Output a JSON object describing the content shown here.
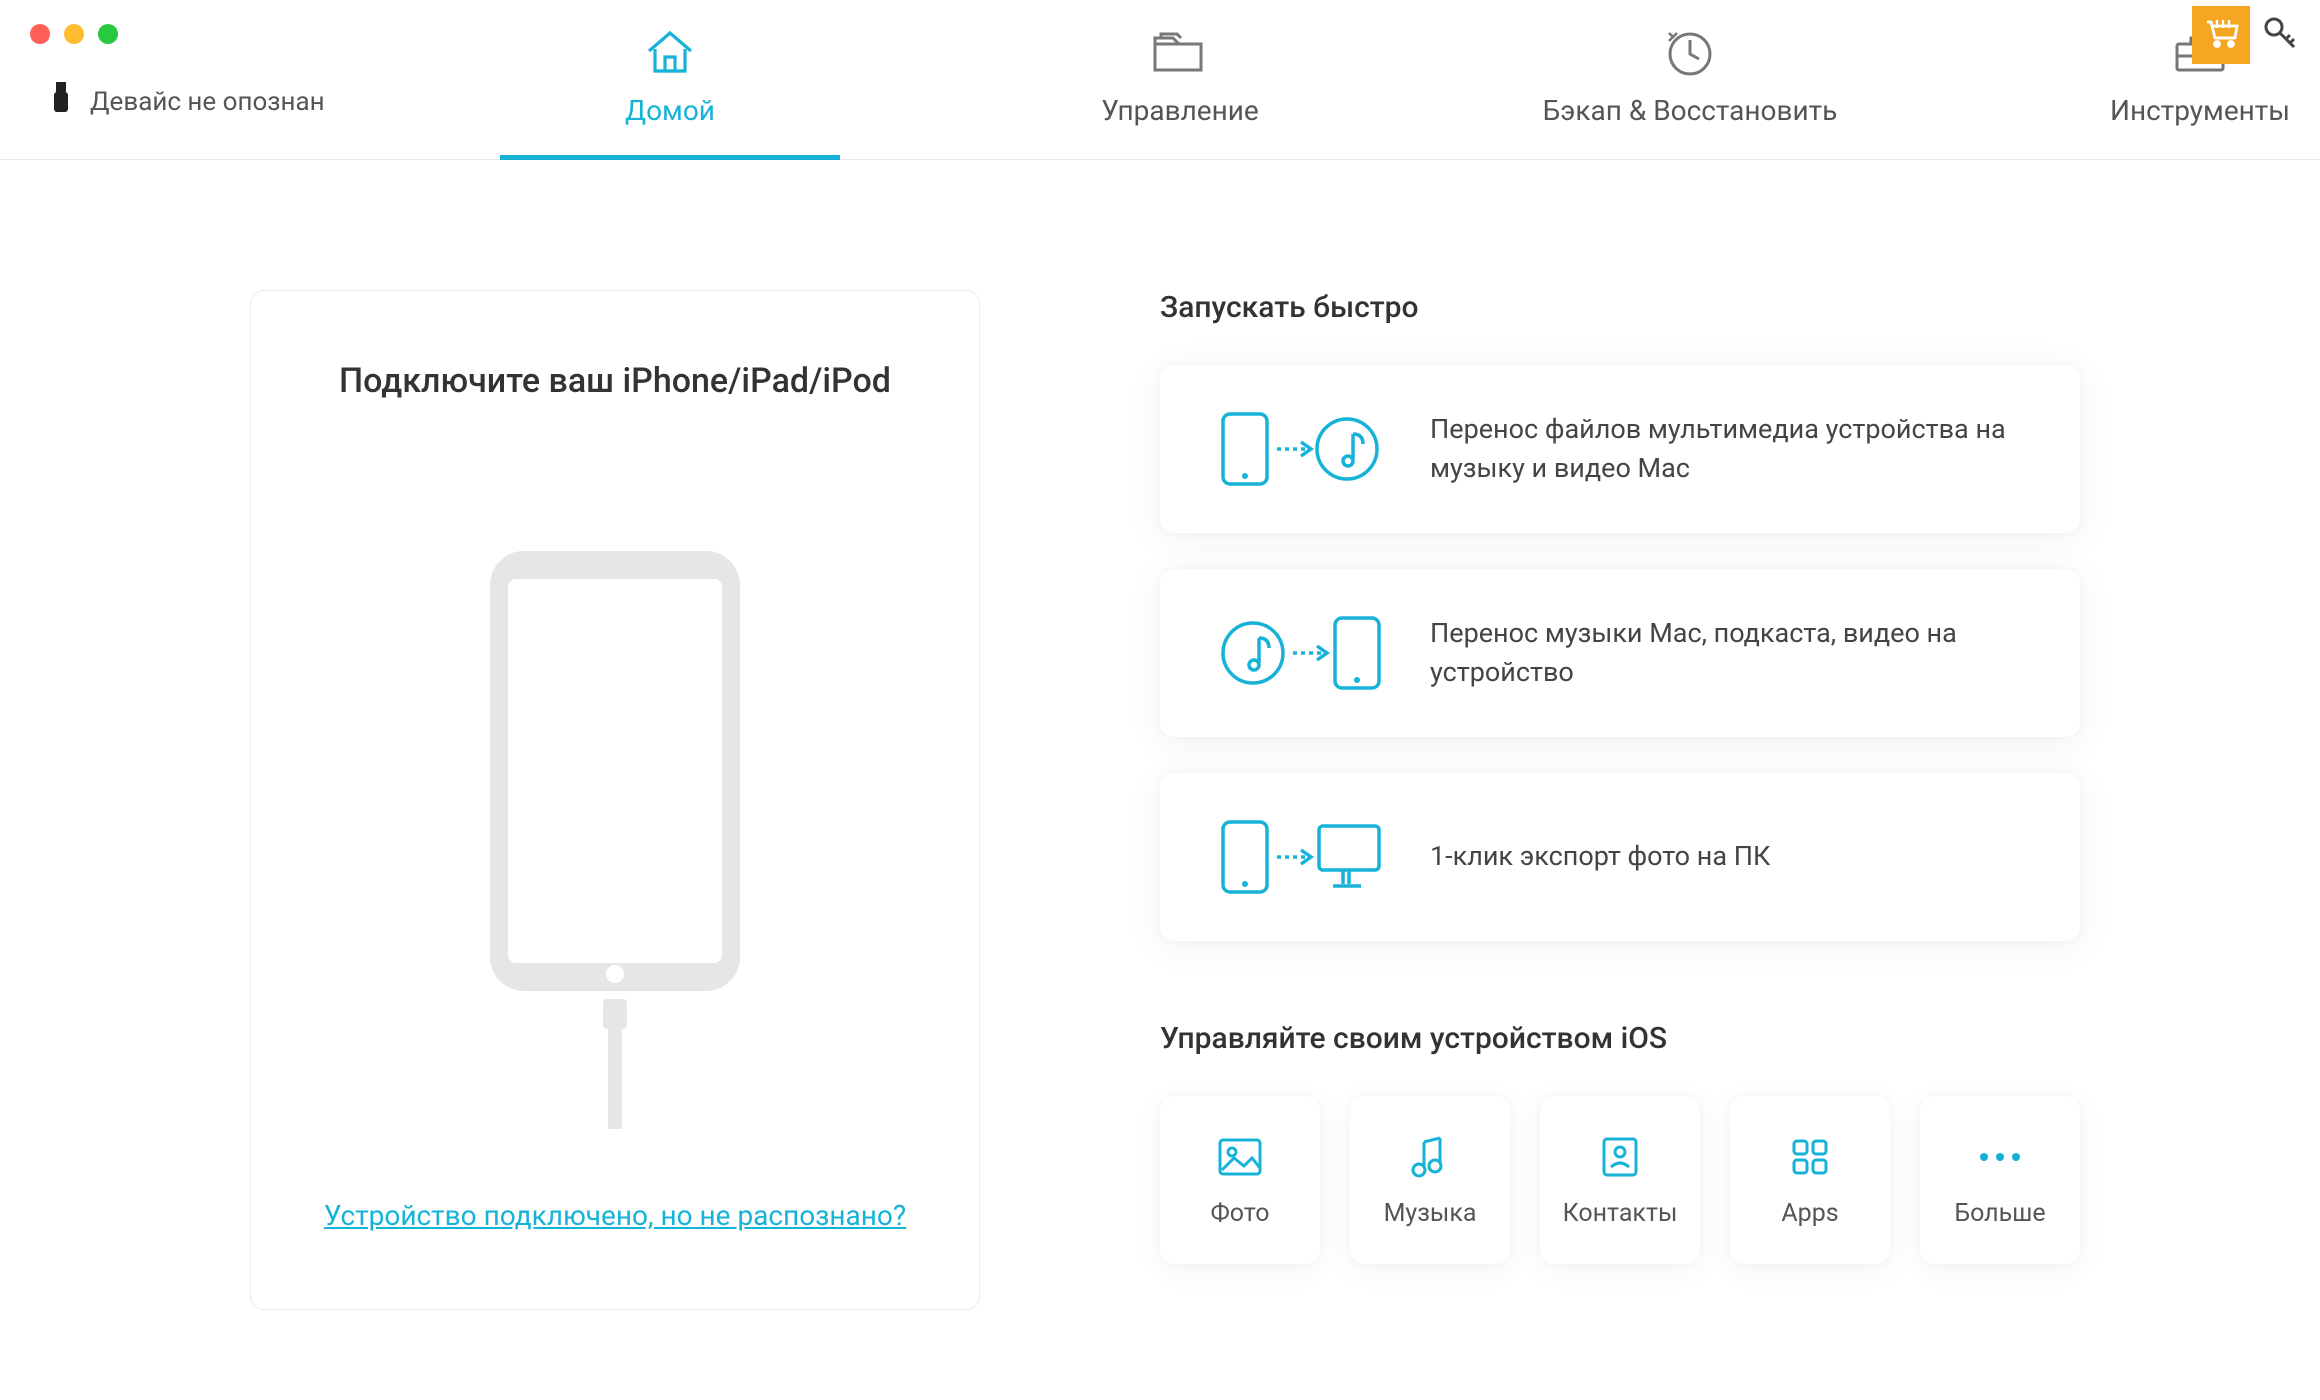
{
  "colors": {
    "accent": "#16b2d8",
    "cart": "#f5a623"
  },
  "status": {
    "text": "Девайс не опознан"
  },
  "nav": {
    "home": "Домой",
    "manage": "Управление",
    "backup": "Бэкап & Восстановить",
    "tools": "Инструменты"
  },
  "device_panel": {
    "heading": "Подключите ваш iPhone/iPad/iPod",
    "help_link": "Устройство подключено, но не распознано?"
  },
  "quick": {
    "title": "Запускать быстро",
    "items": [
      {
        "text": "Перенос файлов мультимедиа устройства на музыку и видео Mac"
      },
      {
        "text": "Перенос музыки Mac, подкаста, видео на устройство"
      },
      {
        "text": "1-клик экспорт фото на ПК"
      }
    ]
  },
  "manage": {
    "title": "Управляйте своим устройством iOS",
    "tiles": {
      "photo": "Фото",
      "music": "Музыка",
      "contacts": "Контакты",
      "apps": "Apps",
      "more": "Больше"
    }
  }
}
